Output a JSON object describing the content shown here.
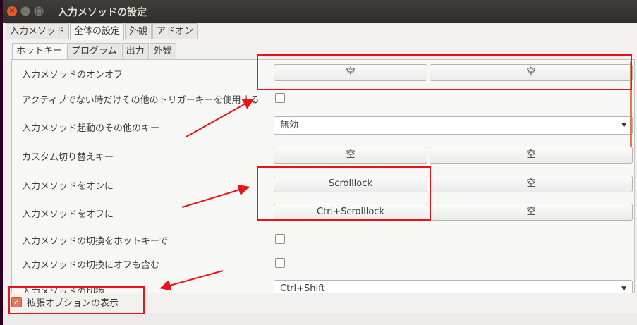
{
  "window": {
    "title": "入力メソッドの設定",
    "controls": {
      "close": "×",
      "minimize": "−",
      "maximize": "□"
    }
  },
  "main_tabs": [
    "入力メソッド",
    "全体の設定",
    "外観",
    "アドオン"
  ],
  "sub_tabs": [
    "ホットキー",
    "プログラム",
    "出力",
    "外観"
  ],
  "rows": {
    "toggle": {
      "label": "入力メソッドのオンオフ",
      "key1": "空",
      "key2": "空"
    },
    "inactive_trigger": {
      "label": "アクティブでない時だけその他のトリガーキーを使用する"
    },
    "startup_other": {
      "label": "入力メソッド起動のその他のキー",
      "value": "無効"
    },
    "custom_switch": {
      "label": "カスタム切り替えキー",
      "key1": "空",
      "key2": "空"
    },
    "turn_on": {
      "label": "入力メソッドをオンに",
      "key1": "Scrolllock",
      "key2": "空"
    },
    "turn_off": {
      "label": "入力メソッドをオフに",
      "key1": "Ctrl+Scrolllock",
      "key2": "空"
    },
    "switch_hotkey": {
      "label": "入力メソッドの切換をホットキーで"
    },
    "switch_include_off": {
      "label": "入力メソッドの切換にオフも含む"
    },
    "switch": {
      "label": "入力メソッドの切換",
      "value": "Ctrl+Shift"
    }
  },
  "extended_options": {
    "label": "拡張オプションの表示",
    "checked": true
  },
  "colors": {
    "accent": "#e07a50",
    "annotation": "#e8141a",
    "titlebar": "#3c3b37"
  }
}
